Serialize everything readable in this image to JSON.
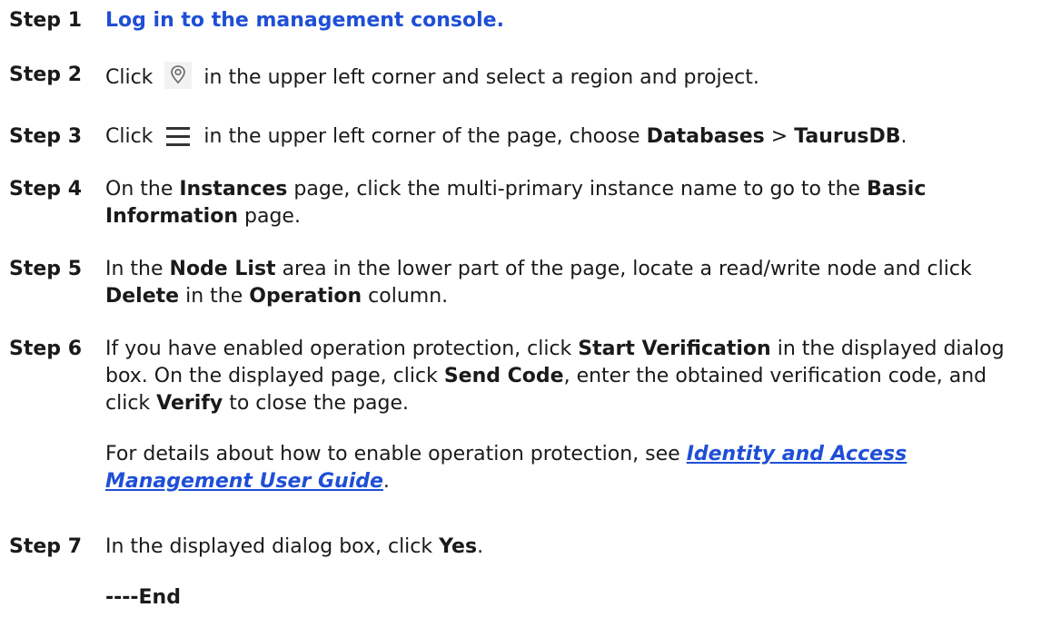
{
  "steps": [
    {
      "label": "Step 1",
      "link": "Log in to the management console."
    },
    {
      "label": "Step 2",
      "pre": "Click",
      "icon": "location-pin-icon",
      "post": "in the upper left corner and select a region and project."
    },
    {
      "label": "Step 3",
      "pre": "Click",
      "icon": "hamburger-menu-icon",
      "post": "in the upper left corner of the page, choose",
      "b1": "Databases",
      "sep": ">",
      "b2": "TaurusDB",
      "end": "."
    },
    {
      "label": "Step 4",
      "t1": "On the",
      "b1": "Instances",
      "t2": "page, click the multi-primary instance name to go to the",
      "b2": "Basic Information",
      "t3": "page."
    },
    {
      "label": "Step 5",
      "t1": "In the",
      "b1": "Node List",
      "t2": "area in the lower part of the page, locate a read/write node and click",
      "b2": "Delete",
      "t3": "in the",
      "b3": "Operation",
      "t4": "column."
    },
    {
      "label": "Step 6",
      "t1": "If you have enabled operation protection, click",
      "b1": "Start Verification",
      "t2": "in the displayed dialog box. On the displayed page, click",
      "b2": "Send Code",
      "t3": ", enter the obtained verification code, and click",
      "b3": "Verify",
      "t4": "to close the page.",
      "note_pre": "For details about how to enable operation protection, see",
      "note_link": "Identity and Access Management User Guide",
      "note_end": "."
    },
    {
      "label": "Step 7",
      "t1": "In the displayed dialog box, click",
      "b1": "Yes",
      "t2": "."
    }
  ],
  "end_marker": "----End",
  "colors": {
    "link": "#1f4fd6",
    "text": "#1a1a1a"
  }
}
